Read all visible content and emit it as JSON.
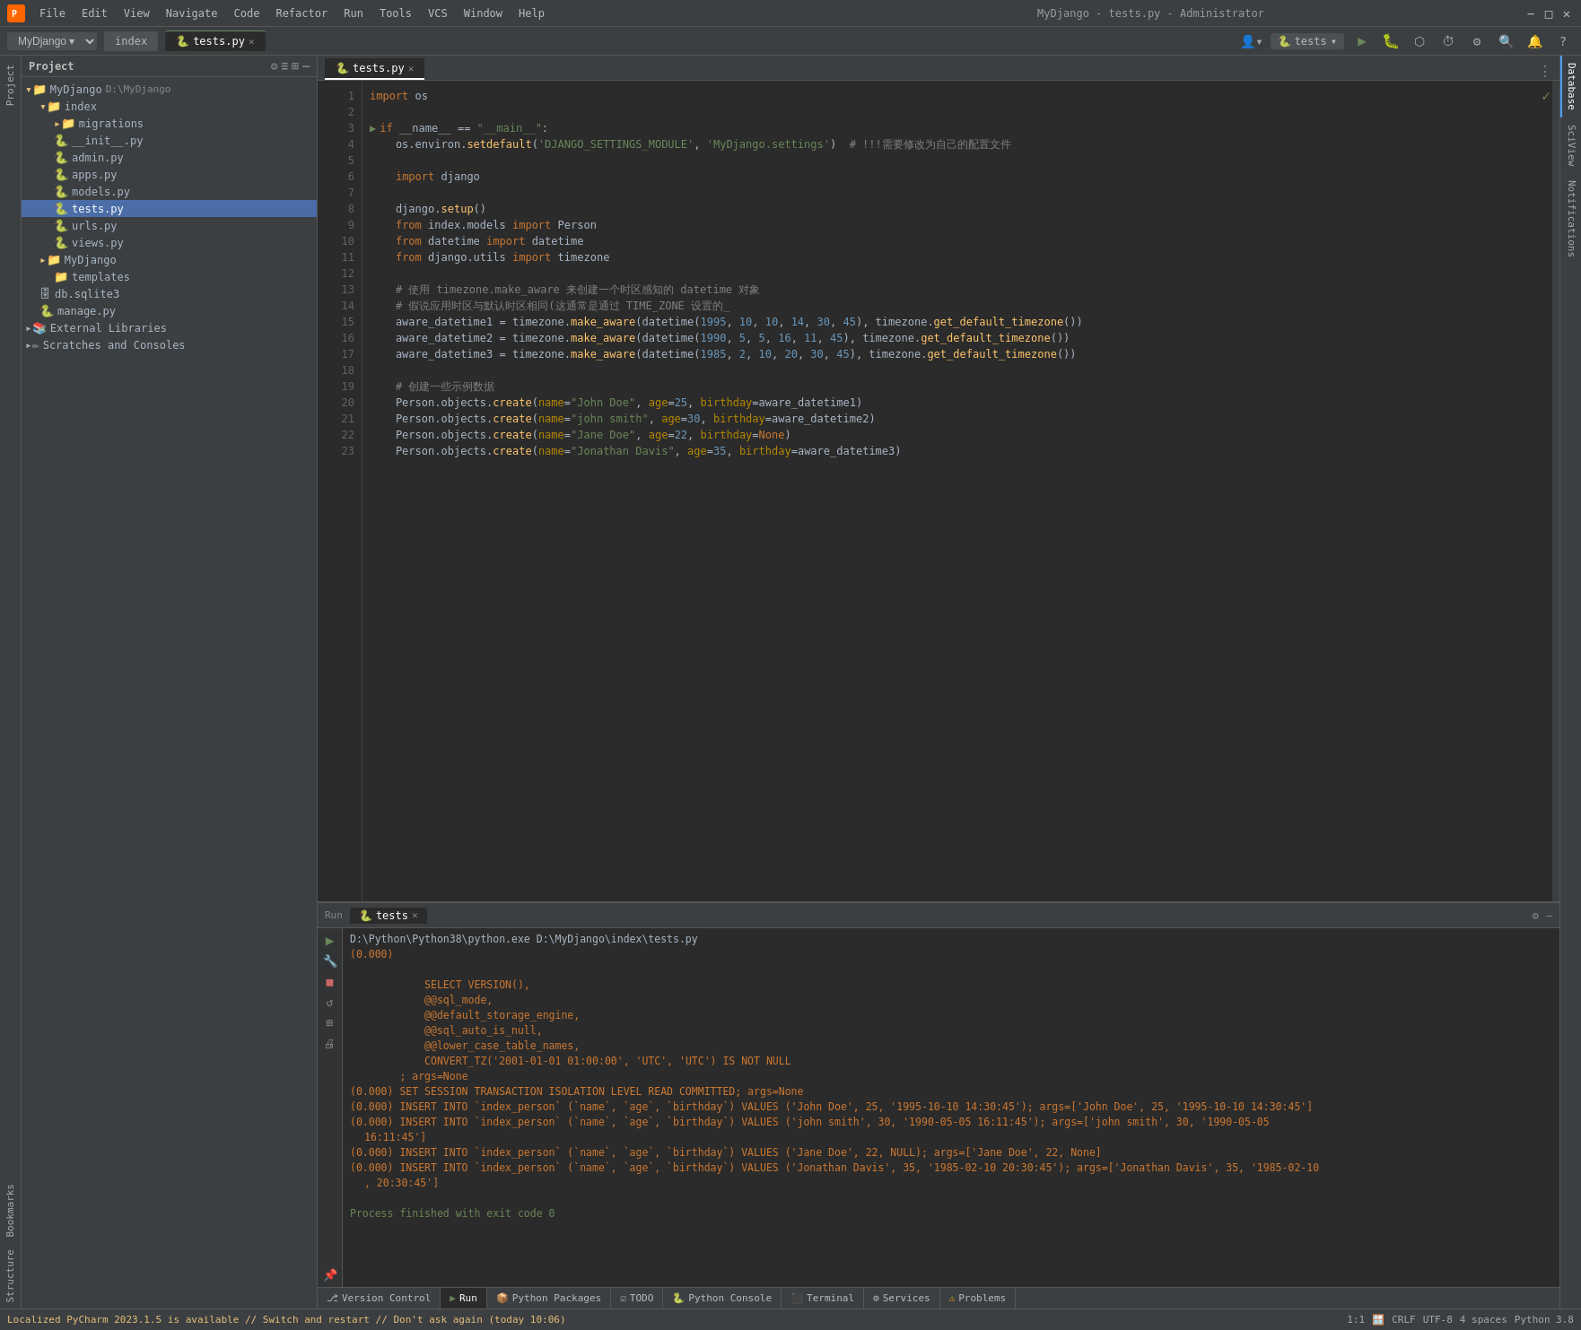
{
  "app": {
    "title": "MyDjango - tests.py - Administrator",
    "icon": "PY"
  },
  "menu": {
    "items": [
      "File",
      "Edit",
      "View",
      "Navigate",
      "Code",
      "Refactor",
      "Run",
      "Tools",
      "VCS",
      "Window",
      "Help"
    ]
  },
  "tabs": {
    "project_label": "MyDjango",
    "open_files": [
      "index",
      "tests.py"
    ]
  },
  "run_config": {
    "name": "tests",
    "icon": "▶"
  },
  "file_tree": {
    "title": "Project",
    "root": "MyDjango",
    "root_path": "D:\\MyDjango",
    "items": [
      {
        "indent": 0,
        "label": "MyDjango",
        "type": "root",
        "path": "D:\\MyDjango"
      },
      {
        "indent": 1,
        "label": "index",
        "type": "folder"
      },
      {
        "indent": 2,
        "label": "migrations",
        "type": "folder"
      },
      {
        "indent": 2,
        "label": "__init__.py",
        "type": "py"
      },
      {
        "indent": 2,
        "label": "admin.py",
        "type": "py"
      },
      {
        "indent": 2,
        "label": "apps.py",
        "type": "py"
      },
      {
        "indent": 2,
        "label": "models.py",
        "type": "py"
      },
      {
        "indent": 2,
        "label": "tests.py",
        "type": "py",
        "selected": true
      },
      {
        "indent": 2,
        "label": "urls.py",
        "type": "py"
      },
      {
        "indent": 2,
        "label": "views.py",
        "type": "py"
      },
      {
        "indent": 1,
        "label": "MyDjango",
        "type": "folder"
      },
      {
        "indent": 2,
        "label": "templates",
        "type": "folder"
      },
      {
        "indent": 1,
        "label": "db.sqlite3",
        "type": "db"
      },
      {
        "indent": 1,
        "label": "manage.py",
        "type": "py"
      },
      {
        "indent": 0,
        "label": "External Libraries",
        "type": "folder_closed"
      },
      {
        "indent": 0,
        "label": "Scratches and Consoles",
        "type": "folder_closed"
      }
    ]
  },
  "editor": {
    "filename": "tests.py",
    "lines": [
      "import os",
      "",
      "if __name__ == \"__main__\":",
      "    os.environ.setdefault('DJANGO_SETTINGS_MODULE', 'MyDjango.settings')  # !!!需要修改为自己的配置文件",
      "",
      "    import django",
      "",
      "    django.setup()",
      "    from index.models import Person",
      "    from datetime import datetime",
      "    from django.utils import timezone",
      "",
      "    # 使用 timezone.make_aware 来创建一个时区感知的 datetime 对象",
      "    # 假说应用时区与默认时区相同(这通常是通过 TIME_ZONE 设置的_",
      "    aware_datetime1 = timezone.make_aware(datetime(1995, 10, 10, 14, 30, 45), timezone.get_default_timezone())",
      "    aware_datetime2 = timezone.make_aware(datetime(1990, 5, 5, 16, 11, 45), timezone.get_default_timezone())",
      "    aware_datetime3 = timezone.make_aware(datetime(1985, 2, 10, 20, 30, 45), timezone.get_default_timezone())",
      "",
      "    # 创建一些示例数据",
      "    Person.objects.create(name=\"John Doe\", age=25, birthday=aware_datetime1)",
      "    Person.objects.create(name=\"john smith\", age=30, birthday=aware_datetime2)",
      "    Person.objects.create(name=\"Jane Doe\", age=22, birthday=None)",
      "    Person.objects.create(name=\"Jonathan Davis\", age=35, birthday=aware_datetime3)"
    ]
  },
  "run_panel": {
    "title": "Run",
    "tab_name": "tests",
    "output": [
      "D:\\Python\\Python38\\python.exe D:\\MyDjango\\index\\tests.py",
      "(0.000)",
      "",
      "            SELECT VERSION(),",
      "            @@sql_mode,",
      "            @@default_storage_engine,",
      "            @@sql_auto_is_null,",
      "            @@lower_case_table_names,",
      "            CONVERT_TZ('2001-01-01 01:00:00', 'UTC', 'UTC') IS NOT NULL",
      "        ; args=None",
      "(0.000) SET SESSION TRANSACTION ISOLATION LEVEL READ COMMITTED; args=None",
      "(0.000) INSERT INTO `index_person` (`name`, `age`, `birthday`) VALUES ('John Doe', 25, '1995-10-10 14:30:45'); args=['John Doe', 25, '1995-10-10 14:30:45']",
      "(0.000) INSERT INTO `index_person` (`name`, `age`, `birthday`) VALUES ('john smith', 30, '1990-05-05 16:11:45'); args=['john smith', 30, '1990-05-05 16:11:45']",
      "(0.000) INSERT INTO `index_person` (`name`, `age`, `birthday`) VALUES ('Jane Doe', 22, NULL); args=['Jane Doe', 22, None]",
      "(0.000) INSERT INTO `index_person` (`name`, `age`, `birthday`) VALUES ('Jonathan Davis', 35, '1985-02-10 20:30:45'); args=['Jonathan Davis', 35, '1985-02-10 20:30:45']",
      "",
      "Process finished with exit code 0"
    ]
  },
  "bottom_toolbar": {
    "items": [
      {
        "label": "Version Control",
        "icon": "",
        "active": false
      },
      {
        "label": "Run",
        "icon": "▶",
        "active": true
      },
      {
        "label": "Python Packages",
        "icon": "📦",
        "active": false
      },
      {
        "label": "TODO",
        "icon": "☑",
        "active": false
      },
      {
        "label": "Python Console",
        "icon": "🐍",
        "active": false
      },
      {
        "label": "Terminal",
        "icon": "⬜",
        "active": false
      },
      {
        "label": "Services",
        "icon": "⚙",
        "active": false
      },
      {
        "label": "Problems",
        "icon": "⚠",
        "active": false
      }
    ]
  },
  "status_bar": {
    "warning": "Localized PyCharm 2023.1.5 is available // Switch and restart // Don't ask again (today 10:06)",
    "position": "1:1",
    "line_sep": "CRLF",
    "encoding": "UTF-8",
    "indent": "4 spaces",
    "python": "Python 3.8"
  },
  "right_panels": {
    "tabs": [
      "Database",
      "SciView",
      "Notifications"
    ]
  }
}
